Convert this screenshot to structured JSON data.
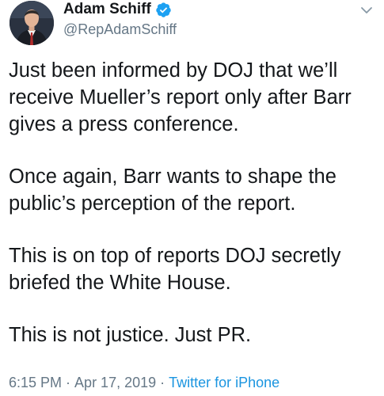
{
  "author": {
    "name": "Adam Schiff",
    "handle": "@RepAdamSchiff",
    "verified": true
  },
  "tweet": {
    "paragraphs": [
      "Just been informed by DOJ that we’ll\nreceive Mueller’s report only after Barr\ngives a press conference.",
      "Once again, Barr wants to shape the\npublic’s perception of the report.",
      "This is on top of reports DOJ secretly\nbriefed the White House.",
      "This is not justice. Just PR."
    ]
  },
  "meta": {
    "time": "6:15 PM",
    "separator": "·",
    "date": "Apr 17, 2019",
    "source": "Twitter for iPhone"
  },
  "icons": {
    "verified": "verified-badge-icon",
    "caret": "chevron-down-icon"
  },
  "colors": {
    "text": "#14171a",
    "secondary": "#657786",
    "accent": "#1b95e0",
    "verified": "#1da1f2"
  }
}
